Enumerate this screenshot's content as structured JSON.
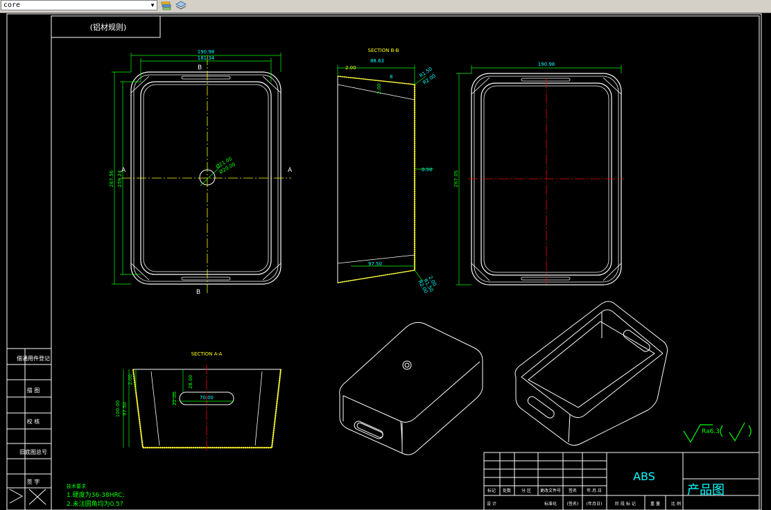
{
  "toolbar": {
    "layer_value": "core",
    "icons": [
      "layer-state-icon",
      "layer-manager-icon"
    ]
  },
  "drawing": {
    "title_box": "(铝材规则)",
    "section_bb": {
      "title": "SECTION B-B",
      "dims": [
        "2.00",
        "88.63",
        "R1.50",
        "2.00",
        "R2.00",
        "8",
        "0.50",
        "97.50",
        "R1.50",
        "R2.00",
        "2.00"
      ]
    },
    "section_aa": {
      "title": "SECTION A-A",
      "dims": [
        "2.00",
        "28.00",
        "22.00",
        "70.00",
        "100.00",
        "97.50"
      ]
    },
    "top_view": {
      "dims": [
        "190.98",
        "181.34",
        "267.56",
        "259.24",
        "Ø21.00",
        "Ø20.00"
      ],
      "labels": [
        "B",
        "B",
        "A",
        "A"
      ]
    },
    "side_view": {
      "dims": [
        "190.98",
        "267.05"
      ]
    },
    "left_strip": [
      "借通用件登记",
      "描 图",
      "校 核",
      "旧底图总号",
      "签 字"
    ],
    "notes": [
      "技术要求",
      "1.硬度为36-38HRC;",
      "2.未注圆角均为0.5?"
    ],
    "roughness": "Ra6.3",
    "title_block": {
      "material": "ABS",
      "drawing_name": "产品图",
      "row1": [
        "标记",
        "处数",
        "分 区",
        "更改文件号",
        "签名",
        "年.月.日"
      ],
      "row2": [
        "设 计",
        "",
        "",
        "标准化",
        "(签名)",
        "(年月日)"
      ],
      "row2_right": [
        "阶 段 标 记",
        "重 量",
        "比 例"
      ]
    }
  },
  "colors": {
    "white": "#ffffff",
    "cyan": "#00ffff",
    "green": "#00ff00",
    "yellow": "#ffff00",
    "red": "#ff0000"
  }
}
